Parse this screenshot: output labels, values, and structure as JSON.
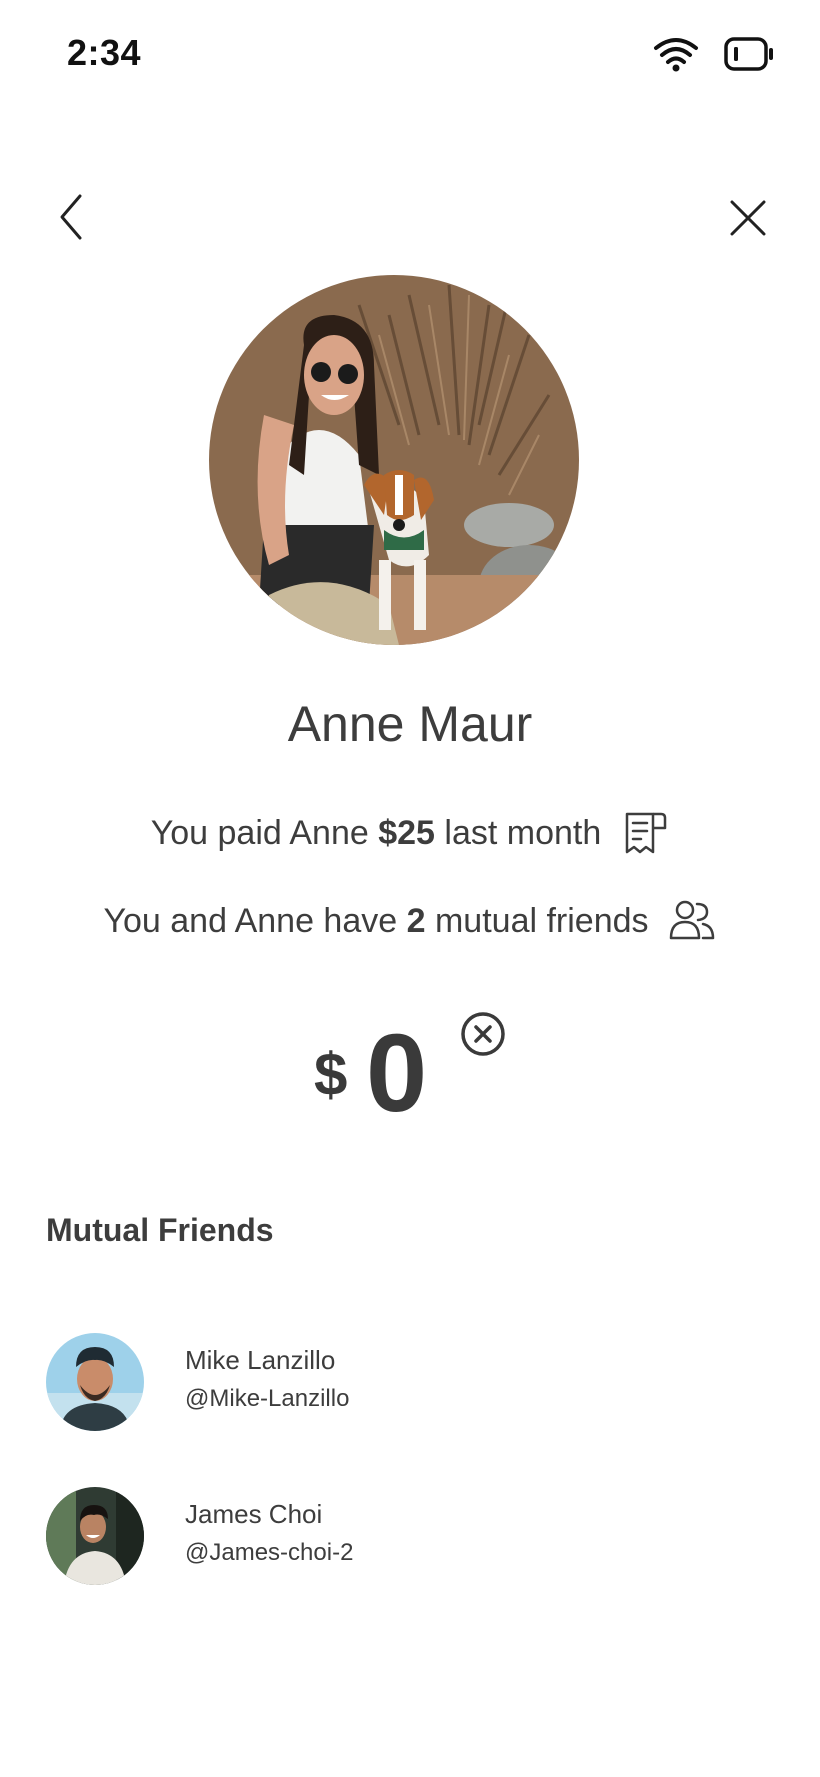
{
  "status_bar": {
    "time": "2:34",
    "icons": [
      "wifi-icon",
      "battery-icon"
    ]
  },
  "nav": {
    "back_icon": "chevron-left-icon",
    "close_icon": "close-icon"
  },
  "profile": {
    "name": "Anne Maur",
    "photo": "woman-with-beagle-photo",
    "paid_prefix": "You paid Anne ",
    "paid_amount": "$25",
    "paid_suffix": " last month",
    "paid_icon": "receipt-icon",
    "mutual_prefix": "You and Anne have ",
    "mutual_count": "2",
    "mutual_suffix": " mutual friends",
    "mutual_icon": "users-icon"
  },
  "amount": {
    "currency": "$",
    "value": "0",
    "clear_icon": "clear-circle-icon"
  },
  "mutual_friends": {
    "title": "Mutual Friends",
    "items": [
      {
        "name": "Mike Lanzillo",
        "handle": "@Mike-Lanzillo"
      },
      {
        "name": "James Choi",
        "handle": "@James-choi-2"
      }
    ]
  },
  "colors": {
    "text": "#3d3d3d",
    "background": "#ffffff"
  }
}
